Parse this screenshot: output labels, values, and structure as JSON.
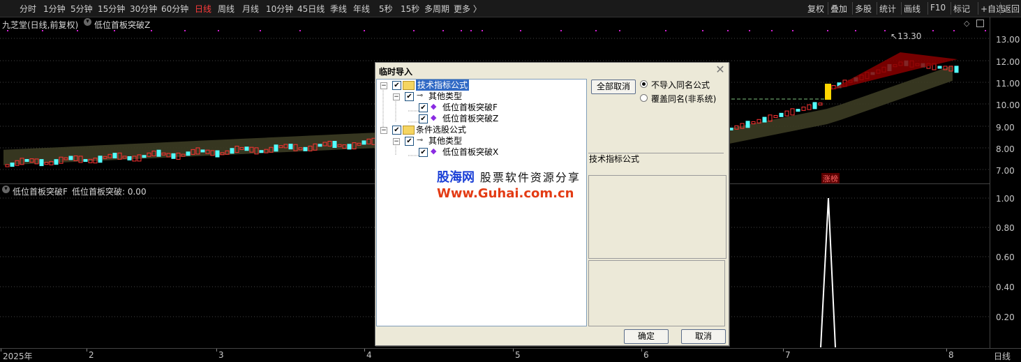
{
  "toolbar": {
    "periods": [
      "分时",
      "1分钟",
      "5分钟",
      "15分钟",
      "30分钟",
      "60分钟",
      "日线",
      "周线",
      "月线",
      "10分钟",
      "45日线",
      "季线",
      "年线",
      "5秒",
      "15秒",
      "多周期",
      "更多 〉"
    ],
    "active_period": "日线",
    "right_buttons": [
      "复权",
      "叠加",
      "多股",
      "统计",
      "画线",
      "F10",
      "标记",
      "+自选",
      "返回"
    ]
  },
  "top_chart": {
    "stock_title": "九芝堂(日线,前复权)",
    "indicator_label": "低位首板突破Z",
    "max_price_label": "13.30",
    "zt_badge": "涨榜"
  },
  "bottom_chart": {
    "indicator_title": "低位首板突破F",
    "value_label": "低位首板突破: 0.00"
  },
  "y_axis_top": [
    "13.00",
    "12.00",
    "11.00",
    "10.00",
    "9.00",
    "8.00",
    "7.00"
  ],
  "y_axis_bottom": [
    "1.00",
    "0.80",
    "0.60",
    "0.40",
    "0.20"
  ],
  "x_axis": {
    "labels": [
      "2025年",
      "2",
      "3",
      "4",
      "5",
      "6",
      "7",
      "8"
    ],
    "period_label": "日线"
  },
  "dialog": {
    "title": "临时导入",
    "tree": {
      "root1": "技术指标公式",
      "root1_child": "其他类型",
      "root1_leaf1": "低位首板突破F",
      "root1_leaf2": "低位首板突破Z",
      "root2": "条件选股公式",
      "root2_child": "其他类型",
      "root2_leaf1": "低位首板突破X"
    },
    "select_all_button": "全部取消",
    "radio_option_1": "不导入同名公式",
    "radio_option_2": "覆盖同名(非系统)",
    "category_label": "技术指标公式",
    "ok_button": "确定",
    "cancel_button": "取消"
  },
  "watermark": {
    "line1_brand": "股海网",
    "line1_slogan": "股票软件资源分享",
    "line2": "Www.Guhai.com.cn"
  },
  "colors": {
    "up": "#ff3333",
    "down": "#54ffff",
    "active_period": "#ff3b3b",
    "background": "#000000",
    "dialog_bg": "#ece9d8",
    "band": "#4a4a2a"
  }
}
